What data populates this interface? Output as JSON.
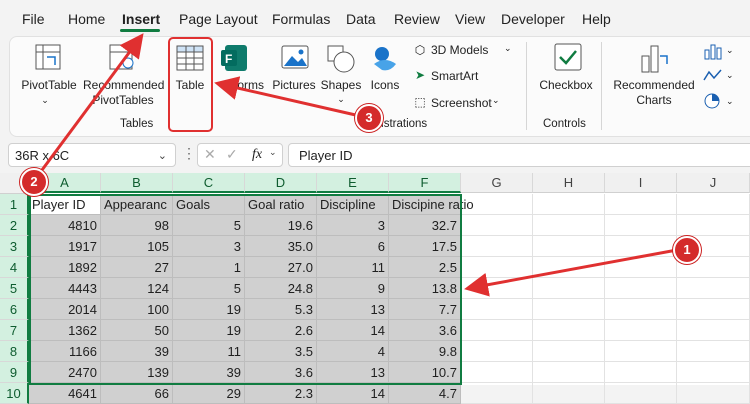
{
  "menu": [
    "File",
    "Home",
    "Insert",
    "Page Layout",
    "Formulas",
    "Data",
    "Review",
    "View",
    "Developer",
    "Help"
  ],
  "ribbon": {
    "pivot_table": "PivotTable",
    "recommended_pivot_1": "Recommended",
    "recommended_pivot_2": "PivotTables",
    "table": "Table",
    "forms": "Forms",
    "pictures": "Pictures",
    "shapes": "Shapes",
    "icons": "Icons",
    "models_3d": "3D Models",
    "smartart": "SmartArt",
    "screenshot": "Screenshot",
    "checkbox": "Checkbox",
    "recommended_charts_1": "Recommended",
    "recommended_charts_2": "Charts",
    "group_tables": "Tables",
    "group_illustrations": "Illustrations",
    "group_controls": "Controls"
  },
  "formula_bar": {
    "name_box": "36R x 6C",
    "fx": "fx",
    "content": "Player ID"
  },
  "columns": [
    "A",
    "B",
    "C",
    "D",
    "E",
    "F",
    "G",
    "H",
    "I",
    "J"
  ],
  "rows": [
    "1",
    "2",
    "3",
    "4",
    "5",
    "6",
    "7",
    "8",
    "9",
    "10"
  ],
  "headers": [
    "Player ID",
    "Appearanc",
    "Goals",
    "Goal ratio",
    "Discipline",
    "Discipine ratio"
  ],
  "data": [
    [
      "4810",
      "98",
      "5",
      "19.6",
      "3",
      "32.7"
    ],
    [
      "1917",
      "105",
      "3",
      "35.0",
      "6",
      "17.5"
    ],
    [
      "1892",
      "27",
      "1",
      "27.0",
      "11",
      "2.5"
    ],
    [
      "4443",
      "124",
      "5",
      "24.8",
      "9",
      "13.8"
    ],
    [
      "2014",
      "100",
      "19",
      "5.3",
      "13",
      "7.7"
    ],
    [
      "1362",
      "50",
      "19",
      "2.6",
      "14",
      "3.6"
    ],
    [
      "1166",
      "39",
      "11",
      "3.5",
      "4",
      "9.8"
    ],
    [
      "2470",
      "139",
      "39",
      "3.6",
      "13",
      "10.7"
    ],
    [
      "4641",
      "66",
      "29",
      "2.3",
      "14",
      "4.7"
    ]
  ],
  "callouts": [
    "1",
    "2",
    "3"
  ],
  "colors": {
    "accent": "#107c41",
    "callout": "#d42b2b"
  }
}
